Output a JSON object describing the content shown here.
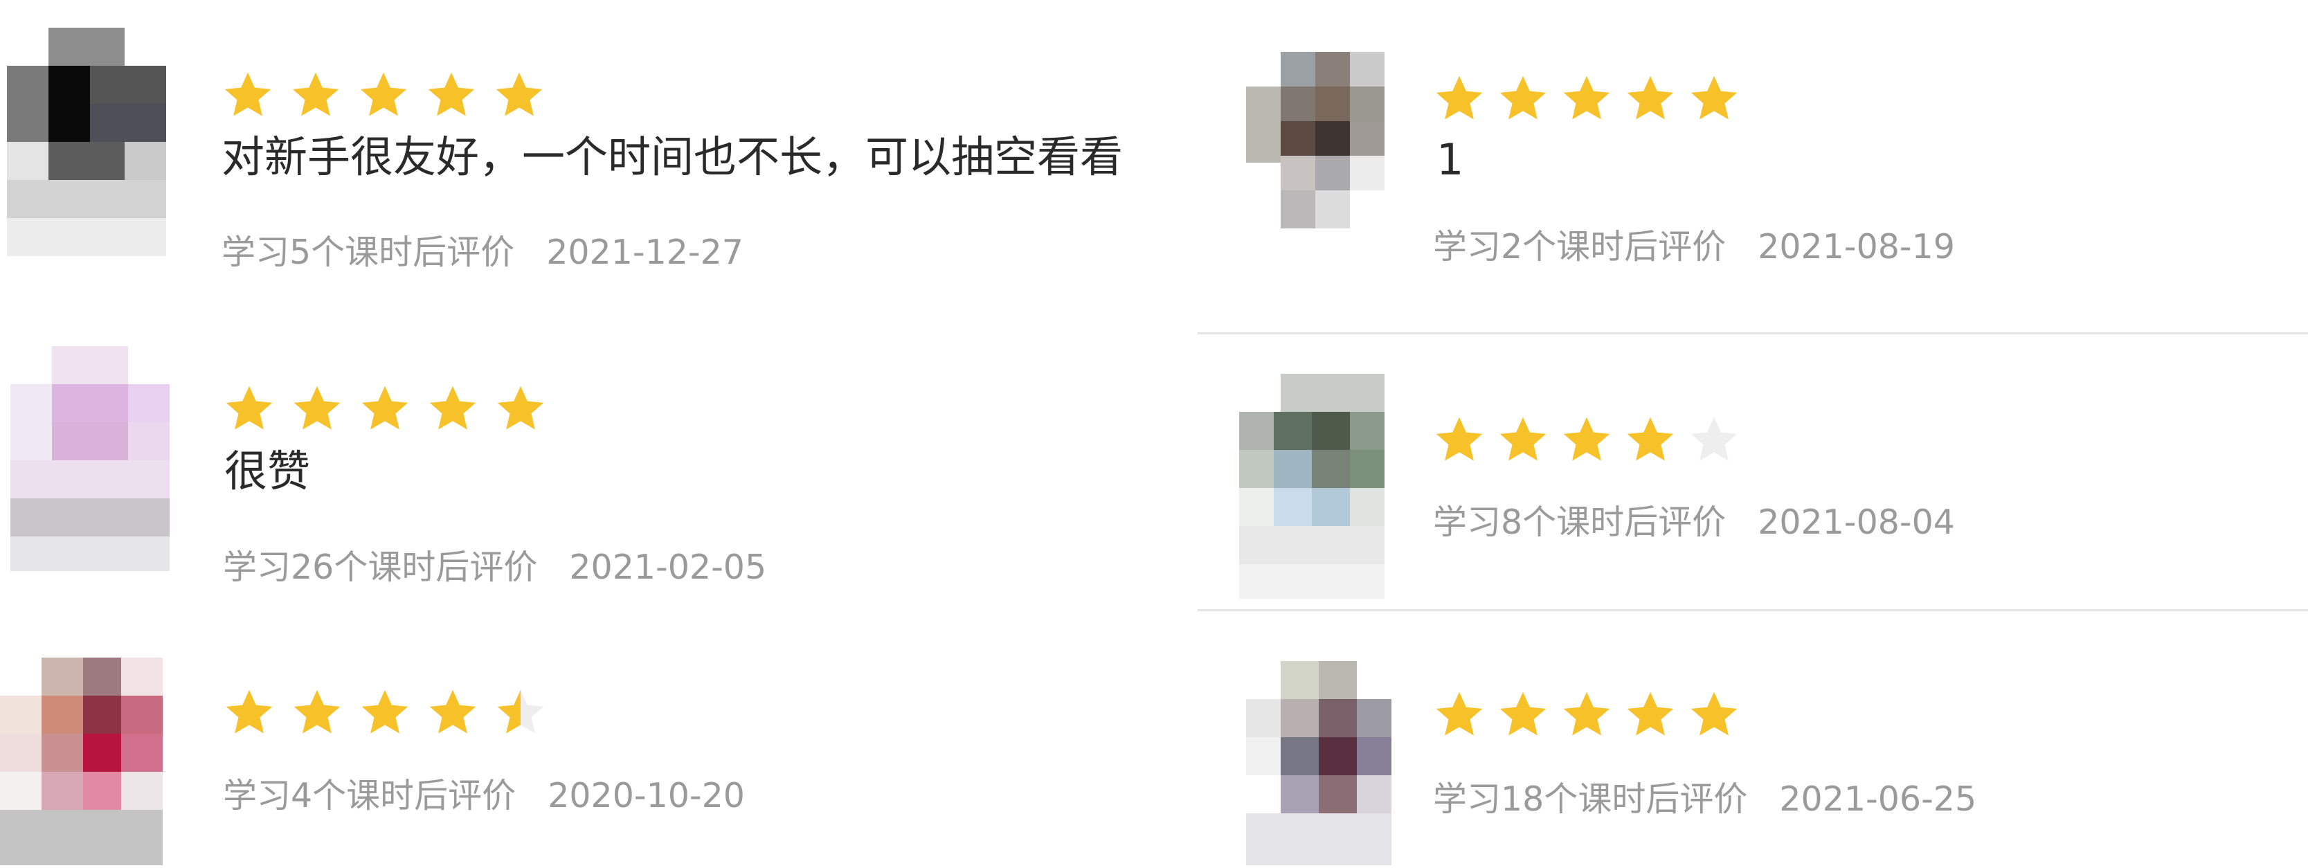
{
  "colors": {
    "star_filled": "#f7c12a",
    "star_empty": "#eeeeee",
    "text": "#2a2a2a",
    "meta": "#9a9a9a",
    "divider": "#e6e6e6"
  },
  "reviews": [
    {
      "rating": 5,
      "comment": "对新手很友好，一个时间也不长，可以抽空看看",
      "study_note": "学习5个课时后评价",
      "date": "2021-12-27"
    },
    {
      "rating": 5,
      "comment": "1",
      "study_note": "学习2个课时后评价",
      "date": "2021-08-19"
    },
    {
      "rating": 5,
      "comment": "很赞",
      "study_note": "学习26个课时后评价",
      "date": "2021-02-05"
    },
    {
      "rating": 4,
      "comment": "",
      "study_note": "学习8个课时后评价",
      "date": "2021-08-04"
    },
    {
      "rating": 4.5,
      "comment": "",
      "study_note": "学习4个课时后评价",
      "date": "2020-10-20"
    },
    {
      "rating": 5,
      "comment": "",
      "study_note": "学习18个课时后评价",
      "date": "2021-06-25"
    }
  ]
}
